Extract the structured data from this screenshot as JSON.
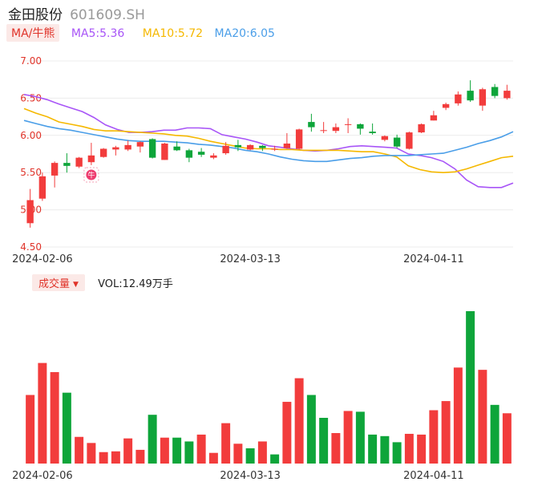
{
  "header": {
    "name": "金田股份",
    "code": "601609.SH"
  },
  "ma_legend": {
    "toggle_label": "MA/牛熊",
    "items": [
      {
        "label": "MA5:5.36",
        "color": "#a855f7"
      },
      {
        "label": "MA10:5.72",
        "color": "#f5b800"
      },
      {
        "label": "MA20:6.05",
        "color": "#4a9ee8"
      }
    ]
  },
  "volume_legend": {
    "toggle_label": "成交量",
    "value_label": "VOL:12.49万手"
  },
  "badge": {
    "label": "牛"
  },
  "colors": {
    "up": "#f23c3c",
    "down": "#0ea53a"
  },
  "chart_data": [
    {
      "type": "candlestick",
      "ylim": [
        4.5,
        7.0
      ],
      "y_ticks": [
        "7.00",
        "6.50",
        "6.00",
        "5.50",
        "5.00",
        "4.50"
      ],
      "x_ticks": [
        {
          "index": 1,
          "label": "2024-02-06"
        },
        {
          "index": 18,
          "label": "2024-03-13"
        },
        {
          "index": 33,
          "label": "2024-04-11"
        }
      ],
      "candles": [
        {
          "o": 4.82,
          "c": 5.13,
          "h": 5.28,
          "l": 4.76
        },
        {
          "o": 5.15,
          "c": 5.45,
          "h": 5.5,
          "l": 5.12
        },
        {
          "o": 5.46,
          "c": 5.63,
          "h": 5.65,
          "l": 5.3
        },
        {
          "o": 5.63,
          "c": 5.59,
          "h": 5.76,
          "l": 5.5
        },
        {
          "o": 5.58,
          "c": 5.7,
          "h": 5.71,
          "l": 5.56
        },
        {
          "o": 5.64,
          "c": 5.73,
          "h": 5.9,
          "l": 5.6
        },
        {
          "o": 5.71,
          "c": 5.82,
          "h": 5.83,
          "l": 5.7
        },
        {
          "o": 5.81,
          "c": 5.84,
          "h": 5.86,
          "l": 5.73
        },
        {
          "o": 5.81,
          "c": 5.87,
          "h": 5.93,
          "l": 5.79
        },
        {
          "o": 5.85,
          "c": 5.91,
          "h": 5.92,
          "l": 5.77
        },
        {
          "o": 5.95,
          "c": 5.7,
          "h": 5.96,
          "l": 5.69
        },
        {
          "o": 5.67,
          "c": 5.89,
          "h": 5.9,
          "l": 5.67
        },
        {
          "o": 5.85,
          "c": 5.8,
          "h": 5.92,
          "l": 5.79
        },
        {
          "o": 5.8,
          "c": 5.7,
          "h": 5.82,
          "l": 5.64
        },
        {
          "o": 5.78,
          "c": 5.74,
          "h": 5.83,
          "l": 5.71
        },
        {
          "o": 5.7,
          "c": 5.73,
          "h": 5.76,
          "l": 5.68
        },
        {
          "o": 5.76,
          "c": 5.86,
          "h": 5.91,
          "l": 5.74
        },
        {
          "o": 5.87,
          "c": 5.84,
          "h": 5.94,
          "l": 5.79
        },
        {
          "o": 5.81,
          "c": 5.87,
          "h": 5.88,
          "l": 5.8
        },
        {
          "o": 5.86,
          "c": 5.83,
          "h": 5.87,
          "l": 5.79
        },
        {
          "o": 5.81,
          "c": 5.82,
          "h": 5.86,
          "l": 5.79
        },
        {
          "o": 5.83,
          "c": 5.89,
          "h": 6.03,
          "l": 5.82
        },
        {
          "o": 5.82,
          "c": 6.08,
          "h": 6.09,
          "l": 5.81
        },
        {
          "o": 6.18,
          "c": 6.11,
          "h": 6.29,
          "l": 6.05
        },
        {
          "o": 6.07,
          "c": 6.07,
          "h": 6.18,
          "l": 6.03
        },
        {
          "o": 6.06,
          "c": 6.11,
          "h": 6.16,
          "l": 6.03
        },
        {
          "o": 6.15,
          "c": 6.15,
          "h": 6.23,
          "l": 6.03
        },
        {
          "o": 6.15,
          "c": 6.09,
          "h": 6.16,
          "l": 6.01
        },
        {
          "o": 6.05,
          "c": 6.03,
          "h": 6.16,
          "l": 6.01
        },
        {
          "o": 5.94,
          "c": 5.99,
          "h": 6.0,
          "l": 5.92
        },
        {
          "o": 5.97,
          "c": 5.85,
          "h": 6.01,
          "l": 5.83
        },
        {
          "o": 5.82,
          "c": 6.04,
          "h": 6.05,
          "l": 5.81
        },
        {
          "o": 6.04,
          "c": 6.15,
          "h": 6.16,
          "l": 6.03
        },
        {
          "o": 6.2,
          "c": 6.27,
          "h": 6.33,
          "l": 6.2
        },
        {
          "o": 6.37,
          "c": 6.42,
          "h": 6.44,
          "l": 6.34
        },
        {
          "o": 6.43,
          "c": 6.55,
          "h": 6.59,
          "l": 6.4
        },
        {
          "o": 6.6,
          "c": 6.47,
          "h": 6.74,
          "l": 6.45
        },
        {
          "o": 6.4,
          "c": 6.62,
          "h": 6.64,
          "l": 6.33
        },
        {
          "o": 6.65,
          "c": 6.53,
          "h": 6.69,
          "l": 6.5
        },
        {
          "o": 6.5,
          "c": 6.6,
          "h": 6.68,
          "l": 6.48
        }
      ],
      "ma_series": [
        {
          "name": "MA5",
          "color": "#a855f7",
          "values": [
            6.55,
            6.52,
            6.48,
            6.42,
            6.37,
            6.32,
            6.24,
            6.14,
            6.08,
            6.04,
            6.04,
            6.05,
            6.07,
            6.07,
            6.1,
            6.1,
            6.09,
            6.01,
            5.98,
            5.95,
            5.91,
            5.86,
            5.84,
            5.82,
            5.8,
            5.79,
            5.8,
            5.82,
            5.85,
            5.86,
            5.85,
            5.84,
            5.83,
            5.75,
            5.73,
            5.7,
            5.65,
            5.55,
            5.4,
            5.31,
            5.3,
            5.3,
            5.36
          ]
        },
        {
          "name": "MA10",
          "color": "#f5b800",
          "values": [
            6.36,
            6.3,
            6.25,
            6.18,
            6.15,
            6.12,
            6.08,
            6.06,
            6.06,
            6.05,
            6.04,
            6.03,
            6.02,
            6.0,
            5.99,
            5.96,
            5.92,
            5.89,
            5.86,
            5.83,
            5.82,
            5.82,
            5.81,
            5.81,
            5.8,
            5.8,
            5.8,
            5.8,
            5.79,
            5.78,
            5.78,
            5.75,
            5.71,
            5.59,
            5.54,
            5.51,
            5.5,
            5.51,
            5.55,
            5.6,
            5.65,
            5.7,
            5.72
          ]
        },
        {
          "name": "MA20",
          "color": "#4a9ee8",
          "values": [
            6.2,
            6.16,
            6.12,
            6.09,
            6.07,
            6.04,
            6.01,
            5.98,
            5.95,
            5.93,
            5.92,
            5.92,
            5.92,
            5.91,
            5.9,
            5.88,
            5.87,
            5.85,
            5.83,
            5.8,
            5.78,
            5.75,
            5.71,
            5.68,
            5.66,
            5.65,
            5.65,
            5.67,
            5.69,
            5.7,
            5.72,
            5.73,
            5.73,
            5.73,
            5.74,
            5.75,
            5.76,
            5.8,
            5.84,
            5.89,
            5.93,
            5.98,
            6.05
          ]
        }
      ],
      "markers": [
        {
          "index": 5,
          "label": "牛"
        }
      ]
    },
    {
      "type": "bar",
      "title": "成交量",
      "ylim": [
        0,
        20
      ],
      "volumes": [
        9.0,
        13.2,
        12.0,
        9.3,
        3.5,
        2.7,
        1.5,
        1.6,
        3.3,
        1.8,
        6.4,
        3.4,
        3.4,
        2.9,
        3.8,
        1.4,
        5.3,
        2.6,
        2.0,
        2.9,
        1.2,
        8.1,
        11.2,
        9.0,
        6.0,
        4.0,
        6.9,
        6.8,
        3.8,
        3.6,
        2.8,
        3.9,
        3.8,
        7.0,
        8.2,
        12.6,
        20.0,
        12.3,
        7.7,
        6.6
      ],
      "directions": [
        "up",
        "up",
        "up",
        "down",
        "up",
        "up",
        "up",
        "up",
        "up",
        "up",
        "down",
        "up",
        "down",
        "down",
        "up",
        "up",
        "up",
        "up",
        "down",
        "up",
        "down",
        "up",
        "up",
        "down",
        "down",
        "up",
        "up",
        "down",
        "down",
        "down",
        "down",
        "up",
        "up",
        "up",
        "up",
        "up",
        "down",
        "up",
        "down",
        "up"
      ]
    }
  ]
}
